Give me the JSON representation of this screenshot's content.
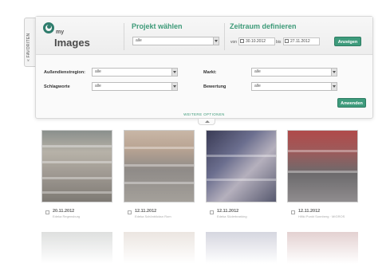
{
  "side_tab": {
    "label": "« FAVORITEN"
  },
  "logo": {
    "my": "my",
    "images": "Images"
  },
  "project": {
    "title": "Projekt wählen",
    "selected": "alle"
  },
  "period": {
    "title": "Zeitraum definieren",
    "from_label": "von",
    "from_value": "30.10.2012",
    "to_label": "bis",
    "to_value": "27.11.2012",
    "show_button": "Anzeigen"
  },
  "filters": {
    "aussendienst_label": "Außendienstregion:",
    "aussendienst_value": "alle",
    "schlagworte_label": "Schlagworte",
    "schlagworte_value": "alle",
    "markt_label": "Markt:",
    "markt_value": "alle",
    "bewertung_label": "Bewertung",
    "bewertung_value": "alle",
    "apply_button": "Anwenden",
    "more_options": "WEITERE OPTIONEN"
  },
  "thumbnails": [
    {
      "date": "20.11.2012",
      "caption": "Edeka Regensburg"
    },
    {
      "date": "12.11.2012",
      "caption": "Edeka Schönblicksn Rom"
    },
    {
      "date": "12.11.2012",
      "caption": "Edeka Süderbrarking"
    },
    {
      "date": "12.11.2012",
      "caption": "Hifiki Punkt Sonnberg · MIGROS"
    }
  ]
}
